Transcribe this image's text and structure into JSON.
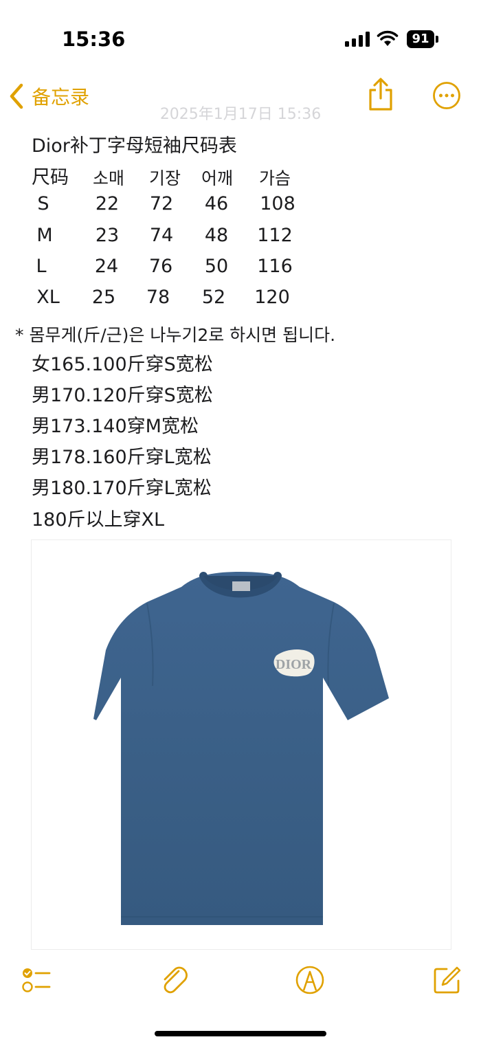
{
  "status": {
    "time": "15:36",
    "battery": "91"
  },
  "nav": {
    "back_label": "备忘录"
  },
  "note": {
    "timestamp": "2025年1月17日 15:36",
    "title": "Dior补丁字母短袖尺码表",
    "table": {
      "header": {
        "label": "尺码",
        "cols": [
          "소매",
          "기장",
          "어깨",
          "가슴"
        ]
      },
      "rows": [
        {
          "size": "S",
          "values": [
            "22",
            "72",
            "46",
            "108"
          ]
        },
        {
          "size": "M",
          "values": [
            "23",
            "74",
            "48",
            "112"
          ]
        },
        {
          "size": "L",
          "values": [
            "24",
            "76",
            "50",
            "116"
          ]
        },
        {
          "size": "XL",
          "values": [
            "25",
            "78",
            "52",
            "120"
          ]
        }
      ]
    },
    "note_line": "* 몸무게(斤/근)은 나누기2로 하시면 됩니다.",
    "recommendations": [
      "女165.100斤穿S宽松",
      "男170.120斤穿S宽松",
      "男173.140穿M宽松",
      "男178.160斤穿L宽松",
      "男180.170斤穿L宽松",
      "180斤以上穿XL"
    ],
    "image": {
      "logo_text": "DIOR",
      "tshirt_color": "#3d6288"
    }
  },
  "colors": {
    "accent": "#e0a100"
  },
  "toolbar": {
    "icons": [
      "checklist-icon",
      "paperclip-icon",
      "markup-pen-icon",
      "compose-icon"
    ]
  }
}
